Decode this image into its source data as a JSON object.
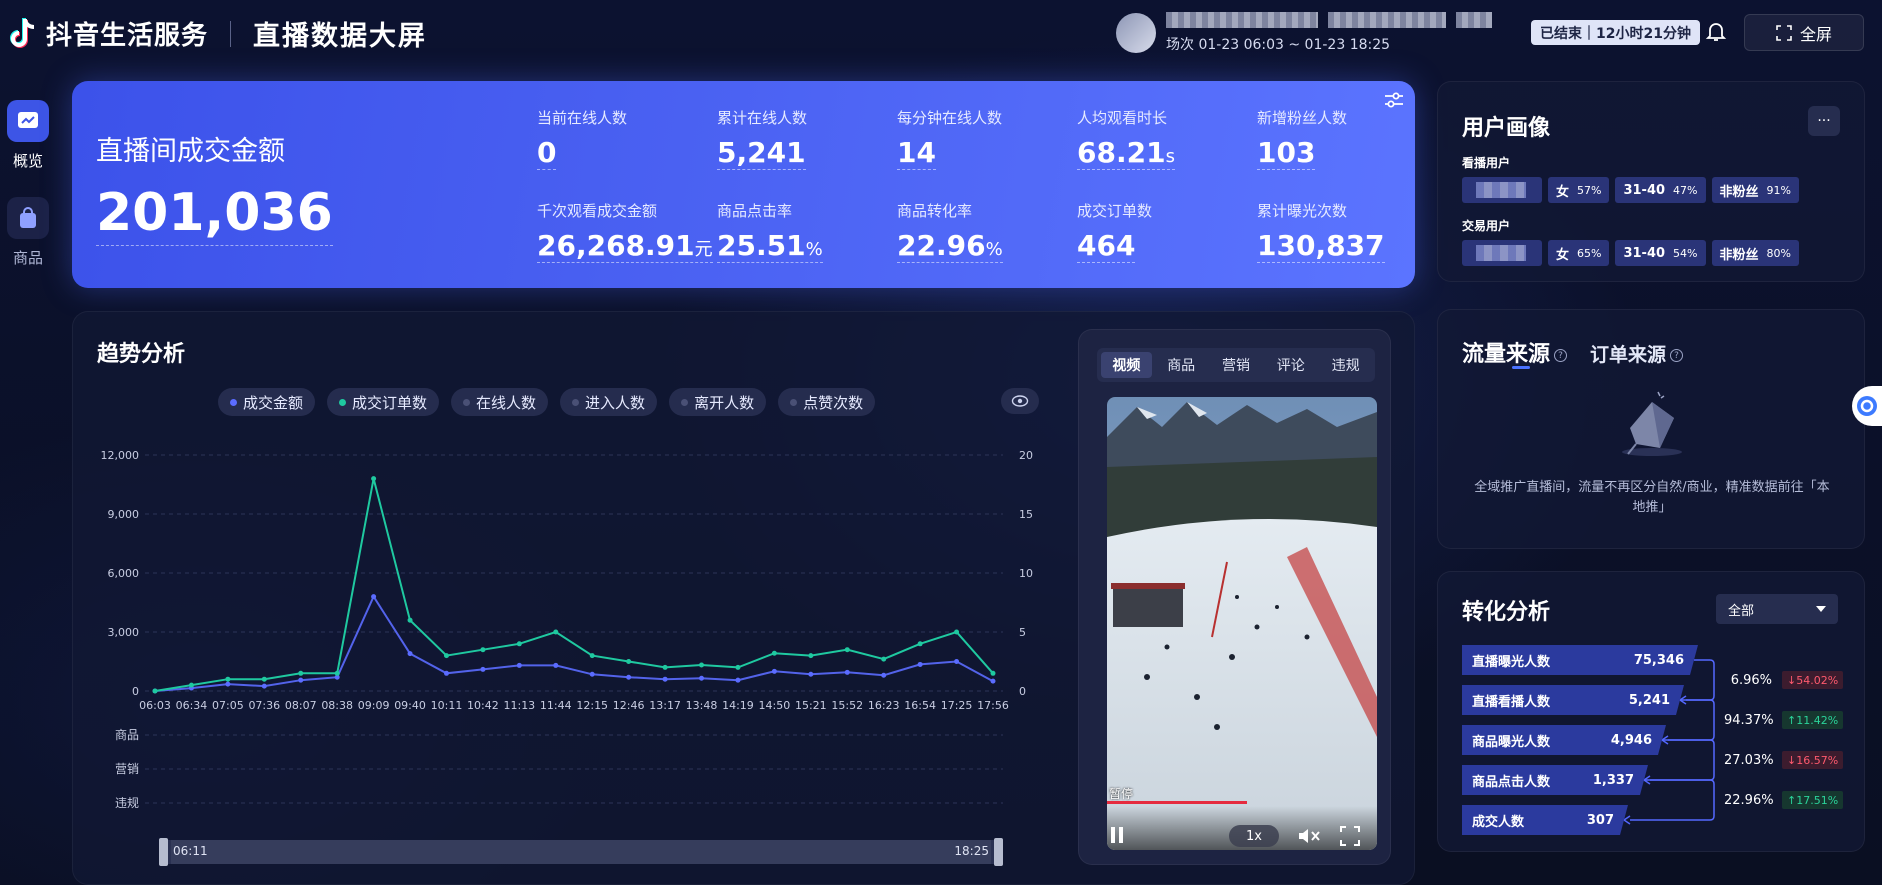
{
  "header": {
    "brand": "抖音生活服务",
    "screen_title": "直播数据大屏",
    "session": "场次 01-23 06:03 ~ 01-23 18:25",
    "status": "已结束｜12小时21分钟",
    "fullscreen_label": "全屏"
  },
  "nav": {
    "items": [
      {
        "label": "概览",
        "icon": "chart-trend-icon",
        "active": true
      },
      {
        "label": "商品",
        "icon": "shopping-bag-icon",
        "active": false
      }
    ]
  },
  "kpi": {
    "main_label": "直播间成交金额",
    "main_value": "201,036",
    "cells": [
      {
        "label": "当前在线人数",
        "value": "0",
        "unit": ""
      },
      {
        "label": "累计在线人数",
        "value": "5,241",
        "unit": ""
      },
      {
        "label": "每分钟在线人数",
        "value": "14",
        "unit": ""
      },
      {
        "label": "人均观看时长",
        "value": "68.21",
        "unit": "s"
      },
      {
        "label": "新增粉丝人数",
        "value": "103",
        "unit": ""
      },
      {
        "label": "千次观看成交金额",
        "value": "26,268.91",
        "unit": "元"
      },
      {
        "label": "商品点击率",
        "value": "25.51",
        "unit": "%"
      },
      {
        "label": "商品转化率",
        "value": "22.96",
        "unit": "%"
      },
      {
        "label": "成交订单数",
        "value": "464",
        "unit": ""
      },
      {
        "label": "累计曝光次数",
        "value": "130,837",
        "unit": ""
      }
    ]
  },
  "trend": {
    "title": "趋势分析",
    "legend": [
      {
        "label": "成交金额",
        "color": "#5b6cff",
        "active": true
      },
      {
        "label": "成交订单数",
        "color": "#1fc9a0",
        "active": true
      },
      {
        "label": "在线人数",
        "color": "#4a5075",
        "active": false
      },
      {
        "label": "进入人数",
        "color": "#4a5075",
        "active": false
      },
      {
        "label": "离开人数",
        "color": "#4a5075",
        "active": false
      },
      {
        "label": "点赞次数",
        "color": "#4a5075",
        "active": false
      }
    ],
    "event_rows": [
      "商品",
      "营销",
      "违规"
    ],
    "slider": {
      "start": "06:11",
      "end": "18:25"
    }
  },
  "chart_data": {
    "type": "line",
    "x": [
      "06:03",
      "06:34",
      "07:05",
      "07:36",
      "08:07",
      "08:38",
      "09:09",
      "09:40",
      "10:11",
      "10:42",
      "11:13",
      "11:44",
      "12:15",
      "12:46",
      "13:17",
      "13:48",
      "14:19",
      "14:50",
      "15:21",
      "15:52",
      "16:23",
      "16:54",
      "17:25",
      "17:56"
    ],
    "y_left": {
      "ticks": [
        "0",
        "3,000",
        "6,000",
        "9,000",
        "12,000"
      ],
      "ylim": [
        0,
        12000
      ]
    },
    "y_right": {
      "ticks": [
        "0",
        "5",
        "10",
        "15",
        "20"
      ],
      "ylim": [
        0,
        20
      ]
    },
    "series": [
      {
        "name": "成交金额",
        "axis": "left",
        "color": "#5b6cff",
        "values": [
          0,
          150,
          350,
          250,
          550,
          700,
          4800,
          1900,
          900,
          1100,
          1300,
          1300,
          850,
          700,
          600,
          650,
          550,
          1000,
          850,
          950,
          800,
          1350,
          1500,
          500
        ]
      },
      {
        "name": "成交订单数",
        "axis": "right",
        "color": "#1fc9a0",
        "values": [
          0,
          0.5,
          1,
          1,
          1.5,
          1.5,
          18,
          6,
          3,
          3.5,
          4,
          5,
          3,
          2.5,
          2,
          2.2,
          2,
          3.2,
          3,
          3.5,
          2.7,
          4,
          5,
          1.5
        ]
      }
    ],
    "grid": true
  },
  "video": {
    "tabs": [
      "视频",
      "商品",
      "营销",
      "评论",
      "违规"
    ],
    "active_tab": 0,
    "paused_label": "暂停",
    "speed": "1x",
    "progress": 0.52
  },
  "persona": {
    "title": "用户画像",
    "more": "···",
    "groups": [
      {
        "label": "看播用户",
        "chips": [
          {
            "name": "女",
            "pct": "57%"
          },
          {
            "name": "31-40",
            "pct": "47%"
          },
          {
            "name": "非粉丝",
            "pct": "91%"
          }
        ]
      },
      {
        "label": "交易用户",
        "chips": [
          {
            "name": "女",
            "pct": "65%"
          },
          {
            "name": "31-40",
            "pct": "54%"
          },
          {
            "name": "非粉丝",
            "pct": "80%"
          }
        ]
      }
    ]
  },
  "traffic": {
    "tab_traffic": "流量来源",
    "tab_orders": "订单来源",
    "message": "全域推广直播间，流量不再区分自然/商业，精准数据前往「本地推」"
  },
  "conversion": {
    "title": "转化分析",
    "select": "全部",
    "funnel": [
      {
        "label": "直播曝光人数",
        "value": "75,346"
      },
      {
        "label": "直播看播人数",
        "value": "5,241"
      },
      {
        "label": "商品曝光人数",
        "value": "4,946"
      },
      {
        "label": "商品点击人数",
        "value": "1,337"
      },
      {
        "label": "成交人数",
        "value": "307"
      }
    ],
    "rates": [
      {
        "rate": "6.96%",
        "change": "↓54.02%",
        "dir": "down"
      },
      {
        "rate": "94.37%",
        "change": "↑11.42%",
        "dir": "up"
      },
      {
        "rate": "27.03%",
        "change": "↓16.57%",
        "dir": "down"
      },
      {
        "rate": "22.96%",
        "change": "↑17.51%",
        "dir": "up"
      }
    ]
  }
}
